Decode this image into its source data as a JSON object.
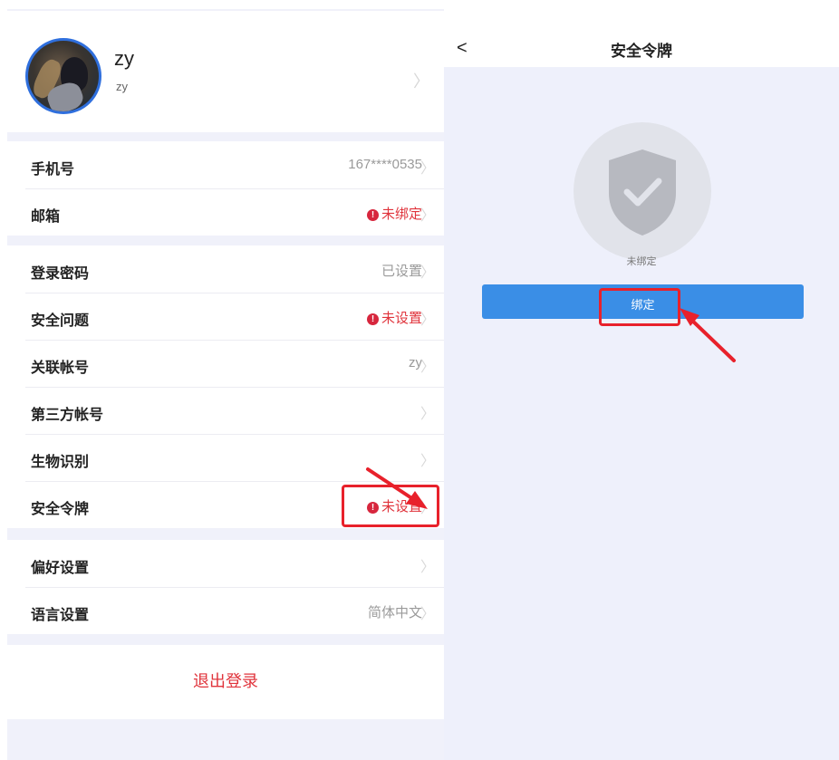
{
  "profile": {
    "name": "zy",
    "subname": "zy"
  },
  "settings_groups": [
    [
      {
        "label": "手机号",
        "value": "167****0535",
        "warn": false
      },
      {
        "label": "邮箱",
        "value": "未绑定",
        "warn": true
      }
    ],
    [
      {
        "label": "登录密码",
        "value": "已设置",
        "warn": false
      },
      {
        "label": "安全问题",
        "value": "未设置",
        "warn": true
      },
      {
        "label": "关联帐号",
        "value": "zy",
        "warn": false
      },
      {
        "label": "第三方帐号",
        "value": "",
        "warn": false
      },
      {
        "label": "生物识别",
        "value": "",
        "warn": false
      },
      {
        "label": "安全令牌",
        "value": "未设置",
        "warn": true
      }
    ],
    [
      {
        "label": "偏好设置",
        "value": "",
        "warn": false
      },
      {
        "label": "语言设置",
        "value": "简体中文",
        "warn": false
      }
    ]
  ],
  "logout": {
    "label": "退出登录"
  },
  "token_page": {
    "back_glyph": "<",
    "title": "安全令牌",
    "status": "未绑定",
    "bind_button": "绑定"
  },
  "colors": {
    "accent": "#3a8ee6",
    "warning": "#e0343c",
    "annotation": "#e8212b",
    "panel_bg": "#eef0fb"
  },
  "icons": [
    "chevron-right-icon",
    "warning-icon",
    "back-icon",
    "shield-check-icon",
    "annotation-arrow"
  ]
}
